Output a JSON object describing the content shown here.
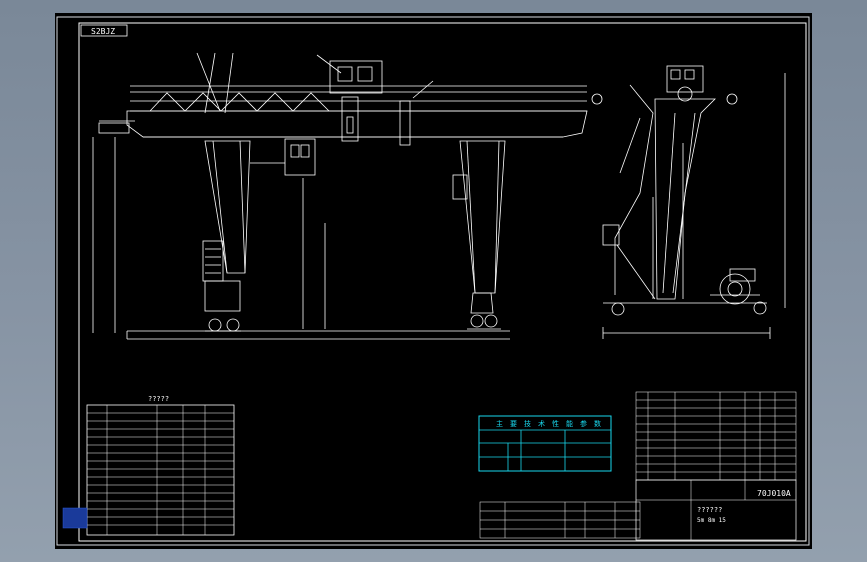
{
  "drawing": {
    "number_tag": "S2BJZ",
    "title_block_code": "70J010A",
    "title_block_lines": [
      "??????",
      "5m  8m  15"
    ],
    "drawing_scale_note": "?????"
  },
  "tables": {
    "left_params_title": "?????",
    "center_table_title_cells": [
      "主",
      "要",
      "技",
      "术",
      "性",
      "能",
      "参",
      "数"
    ]
  },
  "colors": {
    "background": "#000000",
    "lines": "#ffffff",
    "cyan": "#19d8ee",
    "frame": "#d8dde2",
    "desktop": "#8592a2"
  },
  "icons": [
    "crane-elevation-drawing",
    "side-elevation-drawing",
    "parts-list-table",
    "title-block"
  ]
}
